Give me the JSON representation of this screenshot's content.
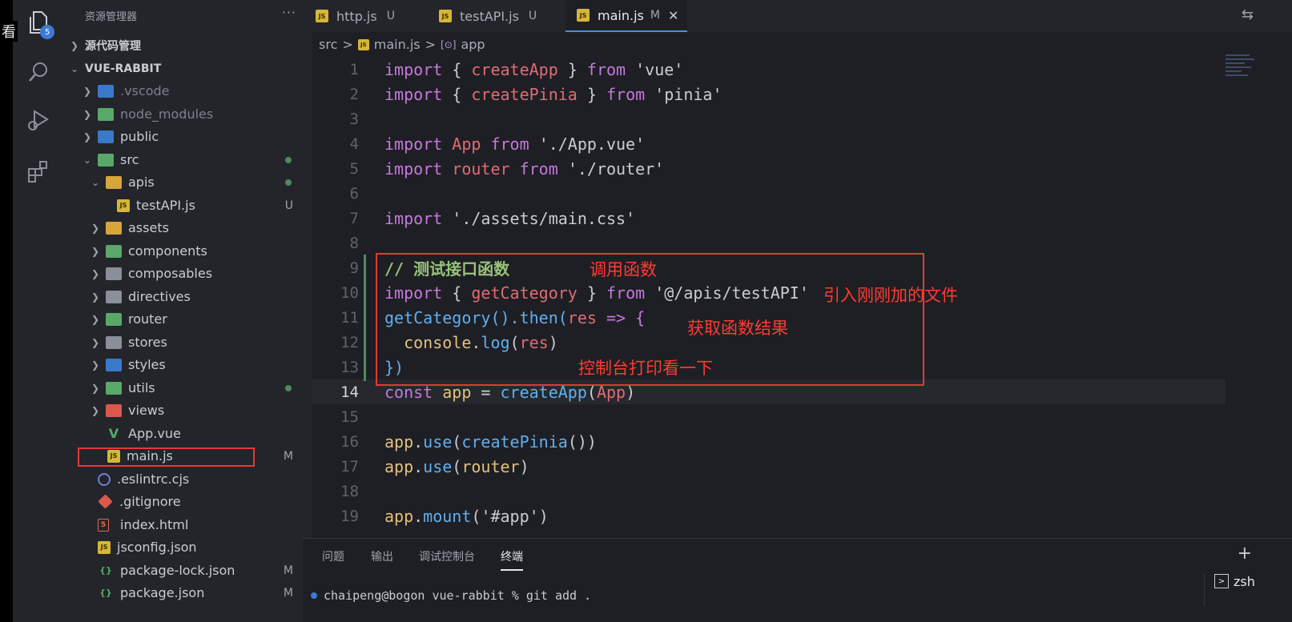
{
  "activity": {
    "badge": "5",
    "overlay_char": "看"
  },
  "sidebar": {
    "header": "资源管理器",
    "more": "···",
    "scm_section": "源代码管理",
    "project": "VUE-RABBIT",
    "items": [
      {
        "label": ".vscode",
        "status": ""
      },
      {
        "label": "node_modules",
        "status": ""
      },
      {
        "label": "public",
        "status": ""
      },
      {
        "label": "src",
        "status": ""
      },
      {
        "label": "apis",
        "status": ""
      },
      {
        "label": "testAPI.js",
        "status": "U"
      },
      {
        "label": "assets",
        "status": ""
      },
      {
        "label": "components",
        "status": ""
      },
      {
        "label": "composables",
        "status": ""
      },
      {
        "label": "directives",
        "status": ""
      },
      {
        "label": "router",
        "status": ""
      },
      {
        "label": "stores",
        "status": ""
      },
      {
        "label": "styles",
        "status": ""
      },
      {
        "label": "utils",
        "status": ""
      },
      {
        "label": "views",
        "status": ""
      },
      {
        "label": "App.vue",
        "status": ""
      },
      {
        "label": "main.js",
        "status": "M"
      },
      {
        "label": ".eslintrc.cjs",
        "status": ""
      },
      {
        "label": ".gitignore",
        "status": ""
      },
      {
        "label": "index.html",
        "status": ""
      },
      {
        "label": "jsconfig.json",
        "status": ""
      },
      {
        "label": "package-lock.json",
        "status": "M"
      },
      {
        "label": "package.json",
        "status": "M"
      }
    ],
    "icons": {
      "js": "JS",
      "vue": "V",
      "html": "5",
      "json": "{}"
    }
  },
  "tabs": [
    {
      "label": "http.js",
      "status": "U"
    },
    {
      "label": "testAPI.js",
      "status": "U"
    },
    {
      "label": "main.js",
      "status": "M",
      "close": "✕"
    }
  ],
  "breadcrumb": {
    "p1": "src",
    "sep": ">",
    "p2": "main.js",
    "sym": "[⊙]",
    "p3": "app"
  },
  "editor": {
    "line_numbers": [
      "1",
      "2",
      "3",
      "4",
      "5",
      "6",
      "7",
      "8",
      "9",
      "10",
      "11",
      "12",
      "13",
      "14",
      "15",
      "16",
      "17",
      "18",
      "19"
    ],
    "tokens": {
      "import": "import",
      "from": "from",
      "const": "const",
      "lb": "{",
      "rb": "}",
      "createApp": "createApp",
      "createPinia": "createPinia",
      "s_vue": "'vue'",
      "s_pinia": "'pinia'",
      "App": "App",
      "s_app": "'./App.vue'",
      "router": "router",
      "s_router": "'./router'",
      "s_css": "'./assets/main.css'",
      "comment": "// 测试接口函数",
      "getCategory": "getCategory",
      "s_testapi": "'@/apis/testAPI'",
      "then_call": "().then(",
      "res": "res",
      "arrow": " => {",
      "console": "console.",
      "log": "log",
      "lp": "(",
      "rp": ")",
      "close13": "})",
      "app": "app",
      "eq": " = ",
      "dot": ".",
      "use": "use",
      "mount": "mount",
      "call_empty": "())",
      "s_hash": "'#app'"
    }
  },
  "annotations": {
    "call": "调用函数",
    "import_file": "引入刚刚加的文件",
    "result": "获取函数结果",
    "console": "控制台打印看一下"
  },
  "panel": {
    "tabs": [
      "问题",
      "输出",
      "调试控制台",
      "终端"
    ],
    "plus": "+",
    "terminal": "chaipeng@bogon vue-rabbit % git add .",
    "shell": "zsh",
    "shell_icon": ">"
  }
}
